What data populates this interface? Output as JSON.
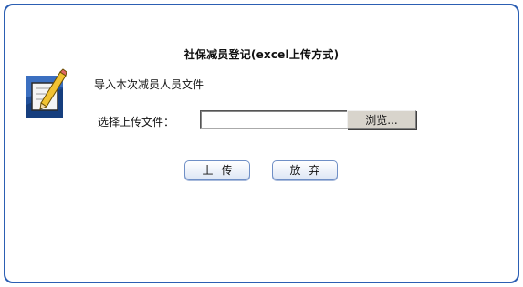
{
  "dialog": {
    "title": "社保减员登记(excel上传方式)",
    "intro_text": "导入本次减员人员文件",
    "file_label": "选择上传文件：",
    "file_value": "",
    "browse_label": "浏览...",
    "upload_label": "上传",
    "cancel_label": "放弃",
    "icon": "edit-document-icon"
  },
  "colors": {
    "border": "#2c5fb3",
    "button_border": "#6f8fc6"
  }
}
